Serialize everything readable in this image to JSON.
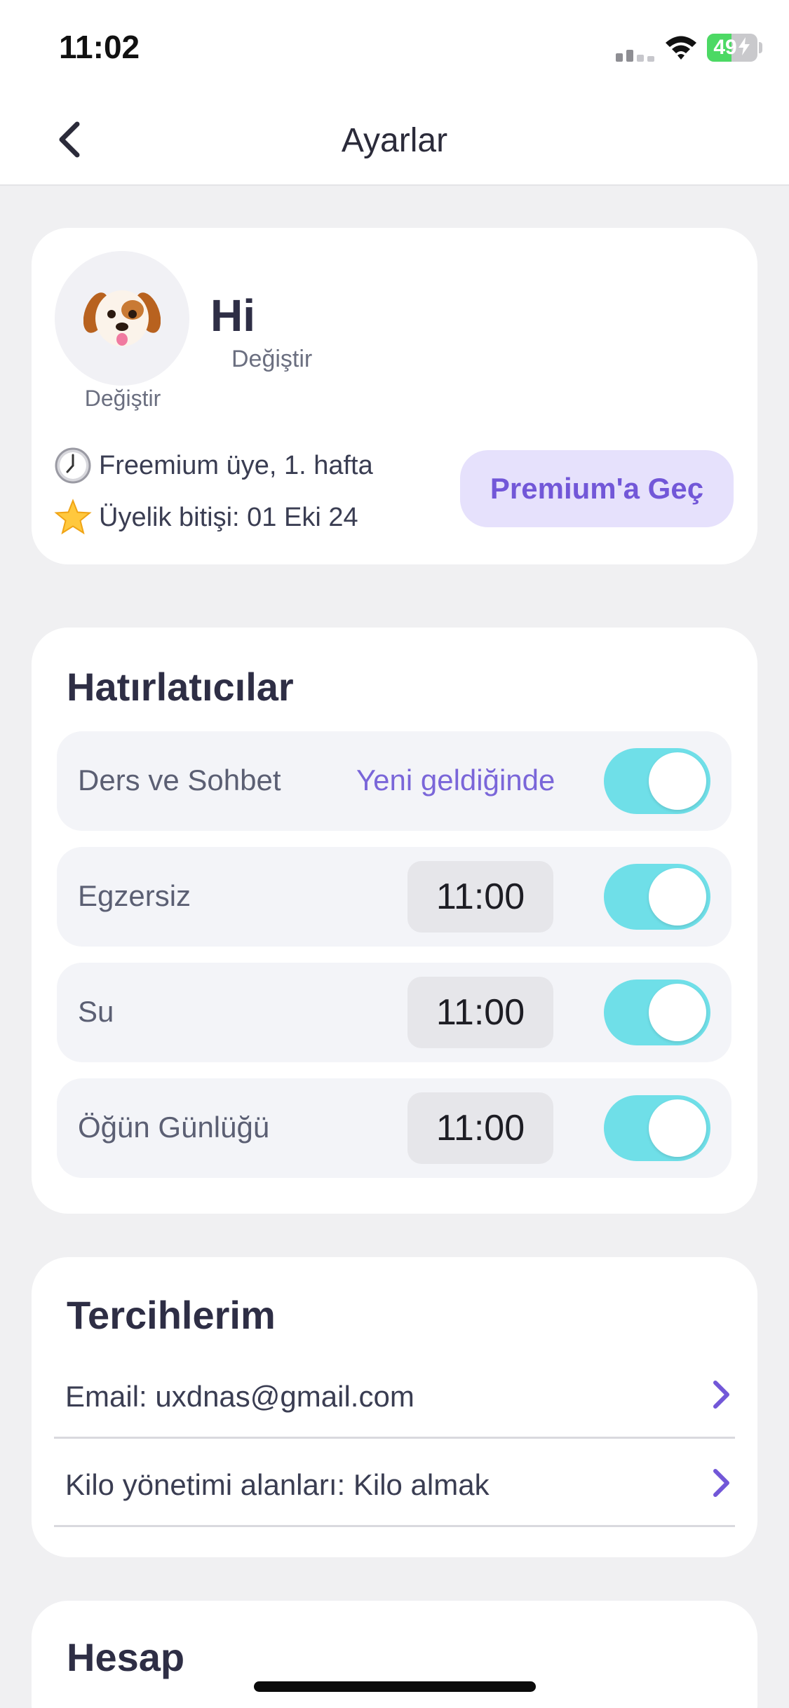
{
  "status_bar": {
    "time": "11:02",
    "battery_percent": 49,
    "battery_label": "49",
    "battery_color": "#4cd964"
  },
  "nav": {
    "title": "Ayarlar",
    "back_icon": "chevron-left-icon"
  },
  "profile": {
    "avatar_icon": "dog-face-icon",
    "avatar_change": "Değiştir",
    "name": "Hi",
    "name_change": "Değiştir",
    "membership": "Freemium üye, 1. hafta",
    "membership_icon": "clock-icon",
    "expiry": "Üyelik bitişi: 01 Eki 24",
    "expiry_icon": "star-icon",
    "premium_button": "Premium'a Geç"
  },
  "reminders": {
    "title": "Hatırlatıcılar",
    "items": [
      {
        "label": "Ders ve Sohbet",
        "mode": "Yeni geldiğinde",
        "enabled": true
      },
      {
        "label": "Egzersiz",
        "time": "11:00",
        "enabled": true
      },
      {
        "label": "Su",
        "time": "11:00",
        "enabled": true
      },
      {
        "label": "Öğün Günlüğü",
        "time": "11:00",
        "enabled": true
      }
    ]
  },
  "preferences": {
    "title": "Tercihlerim",
    "items": [
      {
        "label": "Email: uxdnas@gmail.com"
      },
      {
        "label": "Kilo yönetimi alanları: Kilo almak"
      }
    ]
  },
  "account": {
    "title": "Hesap"
  },
  "colors": {
    "accent": "#7257d8",
    "toggle_on": "#6fdfe8",
    "background": "#f0f0f2"
  }
}
